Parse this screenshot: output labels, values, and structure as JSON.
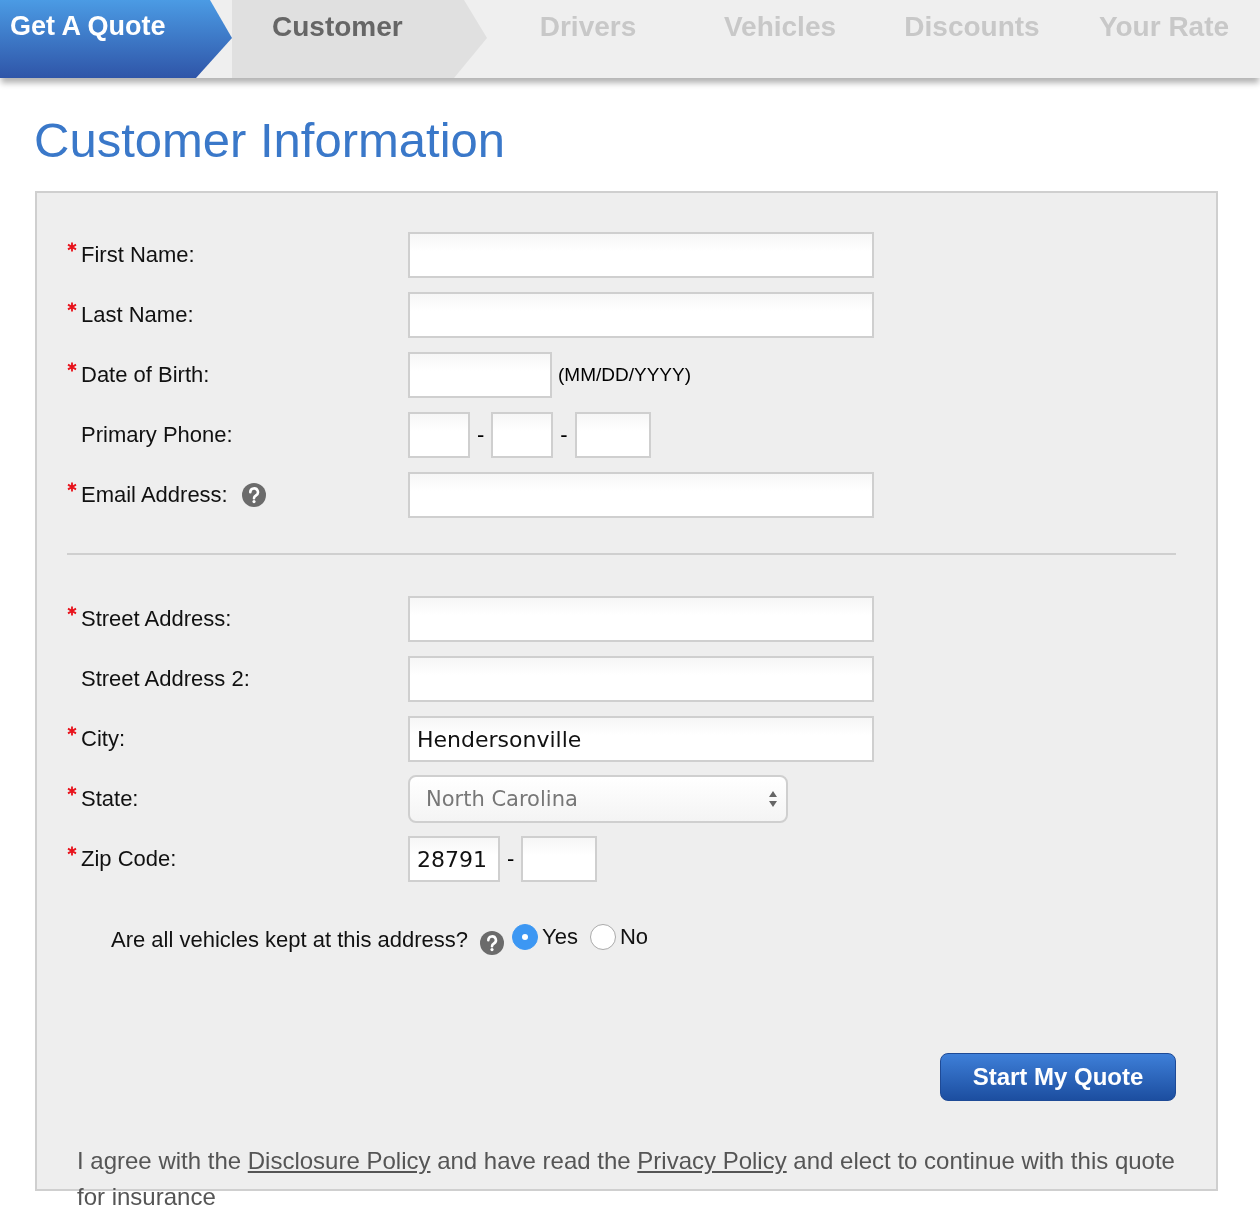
{
  "steps": {
    "brand": "Get A Quote",
    "tabs": [
      {
        "label": "Customer",
        "selected": true
      },
      {
        "label": "Drivers",
        "selected": false
      },
      {
        "label": "Vehicles",
        "selected": false
      },
      {
        "label": "Discounts",
        "selected": false
      },
      {
        "label": "Your Rate",
        "selected": false
      }
    ]
  },
  "title": "Customer Information",
  "form": {
    "groups": [
      {
        "fields": [
          {
            "kind": "text",
            "label": "First Name:",
            "required": true,
            "help": false
          },
          {
            "kind": "text",
            "label": "Last Name:",
            "required": true,
            "help": false
          },
          {
            "kind": "date",
            "label": "Date of Birth:",
            "required": true,
            "help": false,
            "hint": "(MM/DD/YYYY)"
          },
          {
            "kind": "phone",
            "label": "Primary Phone:",
            "required": false,
            "help": false,
            "separators": [
              "-",
              "-"
            ]
          },
          {
            "kind": "text",
            "label": "Email Address:",
            "required": true,
            "help": true
          }
        ]
      },
      {
        "fields": [
          {
            "kind": "text",
            "label": "Street Address:",
            "required": true,
            "help": false
          },
          {
            "kind": "text",
            "label": "Street Address 2:",
            "required": false,
            "help": false
          },
          {
            "kind": "text",
            "label": "City:",
            "required": true,
            "help": false,
            "value": "Hendersonville"
          },
          {
            "kind": "select",
            "label": "State:",
            "required": true,
            "help": false,
            "value": "North Carolina"
          },
          {
            "kind": "zip",
            "label": "Zip Code:",
            "required": true,
            "help": false,
            "value": "28791",
            "separator": "-"
          }
        ]
      }
    ],
    "question": {
      "label": "Are all vehicles kept at this address?",
      "help": true,
      "options": [
        {
          "label": "Yes",
          "selected": true
        },
        {
          "label": "No",
          "selected": false
        }
      ]
    },
    "submit": "Start My Quote",
    "disclaimer": [
      {
        "text": "I agree with the ",
        "link": false
      },
      {
        "text": "Disclosure Policy",
        "link": true
      },
      {
        "text": " and have read the ",
        "link": false
      },
      {
        "text": "Privacy Policy",
        "link": true
      },
      {
        "text": " and elect to continue with this quote for insurance",
        "link": false
      }
    ]
  }
}
